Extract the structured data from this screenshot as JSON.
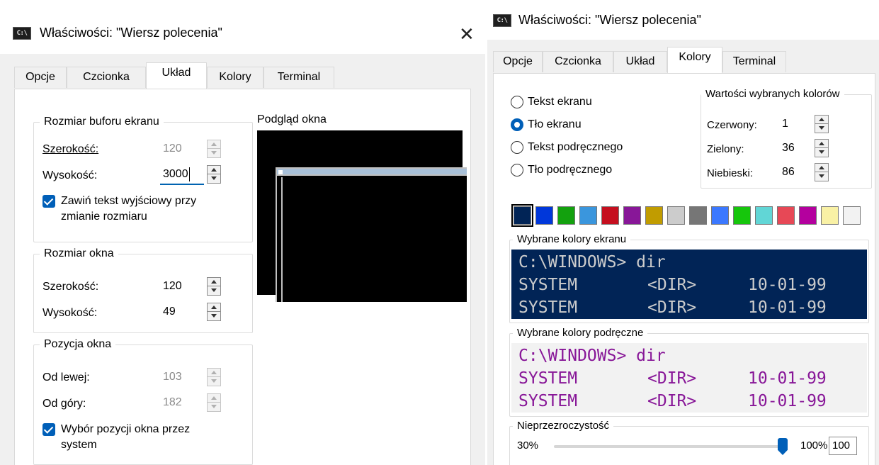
{
  "left_dialog": {
    "title": "Właściwości: \"Wiersz polecenia\"",
    "icon_label": "C:\\",
    "close_glyph": "✕",
    "tabs": [
      "Opcje",
      "Czcionka",
      "Układ",
      "Kolory",
      "Terminal"
    ],
    "active_tab": "Układ",
    "buffer_group": {
      "title": "Rozmiar buforu ekranu",
      "width_label": "Szerokość:",
      "width_value": "120",
      "height_label": "Wysokość:",
      "height_value": "3000",
      "wrap_checkbox_label_line1": "Zawiń tekst wyjściowy przy",
      "wrap_checkbox_label_line2": "zmianie rozmiaru",
      "wrap_checked": true
    },
    "window_size_group": {
      "title": "Rozmiar okna",
      "width_label": "Szerokość:",
      "width_value": "120",
      "height_label": "Wysokość:",
      "height_value": "49"
    },
    "position_group": {
      "title": "Pozycja okna",
      "left_label": "Od lewej:",
      "left_value": "103",
      "top_label": "Od góry:",
      "top_value": "182",
      "system_checkbox_label_line1": "Wybór pozycji okna przez",
      "system_checkbox_label_line2": "system",
      "system_checked": true
    },
    "preview_label": "Podgląd okna"
  },
  "right_dialog": {
    "title": "Właściwości: \"Wiersz polecenia\"",
    "icon_label": "C:\\",
    "tabs": [
      "Opcje",
      "Czcionka",
      "Układ",
      "Kolory",
      "Terminal"
    ],
    "active_tab": "Kolory",
    "radios": [
      "Tekst ekranu",
      "Tło ekranu",
      "Tekst podręcznego",
      "Tło podręcznego"
    ],
    "selected_radio": "Tło ekranu",
    "color_values_group": {
      "title": "Wartości wybranych kolorów",
      "red_label": "Czerwony:",
      "red_value": "1",
      "green_label": "Zielony:",
      "green_value": "36",
      "blue_label": "Niebieski:",
      "blue_value": "86"
    },
    "palette": [
      "#012456",
      "#0037DA",
      "#13A10E",
      "#3A96DD",
      "#C50F1F",
      "#881798",
      "#C19C00",
      "#CCCCCC",
      "#767676",
      "#3B78FF",
      "#16C60C",
      "#61D6D6",
      "#E74856",
      "#B4009E",
      "#F9F1A5",
      "#F2F2F2"
    ],
    "selected_palette_index": 0,
    "screen_colors_group": {
      "title": "Wybrane kolory ekranu",
      "line1": "C:\\WINDOWS> dir",
      "line2_col1": "SYSTEM",
      "line2_col2": "<DIR>",
      "line2_col3": "10-01-99",
      "background": "#012456",
      "foreground": "#CCCCCC"
    },
    "popup_colors_group": {
      "title": "Wybrane kolory podręczne",
      "line1": "C:\\WINDOWS> dir",
      "line2_col1": "SYSTEM",
      "line2_col2": "<DIR>",
      "line2_col3": "10-01-99",
      "background": "#F2F2F2",
      "foreground": "#881798"
    },
    "opacity_group": {
      "title": "Nieprzezroczystość",
      "min_label": "30%",
      "max_label": "100%",
      "value": "100",
      "fraction": 1.0
    }
  }
}
